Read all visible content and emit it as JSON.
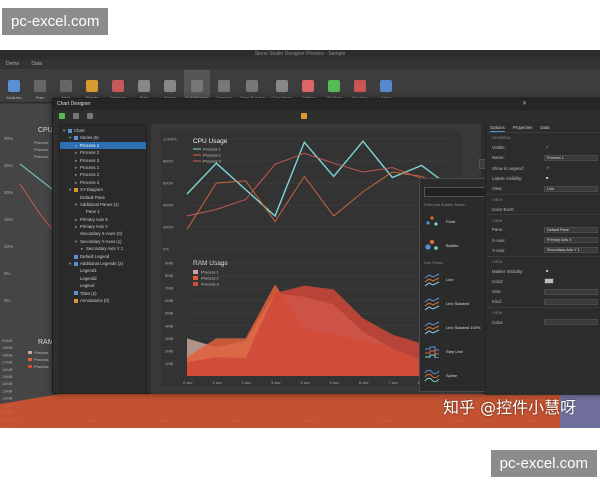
{
  "watermarks": {
    "top": "pc-excel.com",
    "bottom": "pc-excel.com",
    "chinese": "知乎 @控件小慧呀"
  },
  "app": {
    "title": "Stone Studio Designer Preview - Sample",
    "menu": [
      "Demo",
      "Data"
    ],
    "ribbon": [
      {
        "label": "Modules",
        "icon": "modules-icon",
        "color": "#5a8fd4"
      },
      {
        "label": "Prev",
        "icon": "prev-icon",
        "color": "#666"
      },
      {
        "label": "Next",
        "icon": "next-icon",
        "color": "#666"
      },
      {
        "label": "Palette",
        "icon": "palette-icon",
        "color": "#d79a2e"
      },
      {
        "label": "Designer",
        "icon": "designer-icon",
        "color": "#c45a5a"
      },
      {
        "label": "Print",
        "icon": "print-icon",
        "color": "#888"
      },
      {
        "label": "Export",
        "icon": "export-icon",
        "color": "#888"
      },
      {
        "label": "Full Window",
        "icon": "full-window-icon",
        "color": "#777"
      },
      {
        "label": "Compact",
        "icon": "compact-icon",
        "color": "#777"
      },
      {
        "label": "Open Solution",
        "icon": "open-solution-icon",
        "color": "#777"
      },
      {
        "label": "Copy Demo",
        "icon": "copy-demo-icon",
        "color": "#888"
      },
      {
        "label": "Getting",
        "icon": "getting-icon",
        "color": "#d66"
      },
      {
        "label": "Get Free",
        "icon": "get-free-icon",
        "color": "#5b5"
      },
      {
        "label": "Buy Now",
        "icon": "buy-now-icon",
        "color": "#c55"
      },
      {
        "label": "About",
        "icon": "about-icon",
        "color": "#58c"
      }
    ]
  },
  "designer": {
    "title": "Chart Designer",
    "tree": [
      {
        "label": "Chart",
        "indent": 0,
        "arrow": "▾",
        "color": "#5a8fd4"
      },
      {
        "label": "Series (6)",
        "indent": 1,
        "arrow": "▾",
        "color": "#5a8fd4"
      },
      {
        "label": "Process 1",
        "indent": 2,
        "arrow": "▸",
        "color": "",
        "selected": true
      },
      {
        "label": "Process 2",
        "indent": 2,
        "arrow": "▸",
        "color": ""
      },
      {
        "label": "Process 3",
        "indent": 2,
        "arrow": "▸",
        "color": ""
      },
      {
        "label": "Process 1",
        "indent": 2,
        "arrow": "▸",
        "color": ""
      },
      {
        "label": "Process 2",
        "indent": 2,
        "arrow": "▸",
        "color": ""
      },
      {
        "label": "Process 3",
        "indent": 2,
        "arrow": "▸",
        "color": ""
      },
      {
        "label": "XY-Diagram",
        "indent": 1,
        "arrow": "▾",
        "color": "#d79a2e"
      },
      {
        "label": "Default Pane",
        "indent": 2,
        "arrow": "",
        "color": ""
      },
      {
        "label": "Additional Panes (1)",
        "indent": 2,
        "arrow": "▾",
        "color": ""
      },
      {
        "label": "Pane 1",
        "indent": 3,
        "arrow": "",
        "color": ""
      },
      {
        "label": "Primary Axis X",
        "indent": 2,
        "arrow": "▸",
        "color": ""
      },
      {
        "label": "Primary Axis Y",
        "indent": 2,
        "arrow": "▸",
        "color": ""
      },
      {
        "label": "Secondary X-Axes (0)",
        "indent": 2,
        "arrow": "",
        "color": ""
      },
      {
        "label": "Secondary Y-Axes (1)",
        "indent": 2,
        "arrow": "▾",
        "color": ""
      },
      {
        "label": "Secondary Axis Y 1",
        "indent": 3,
        "arrow": "▸",
        "color": ""
      },
      {
        "label": "Default Legend",
        "indent": 1,
        "arrow": "",
        "color": "#5a8fd4"
      },
      {
        "label": "Additional Legends (2)",
        "indent": 1,
        "arrow": "▾",
        "color": "#5a8fd4"
      },
      {
        "label": "Legend1",
        "indent": 2,
        "arrow": "",
        "color": ""
      },
      {
        "label": "Legend2",
        "indent": 2,
        "arrow": "",
        "color": ""
      },
      {
        "label": "Legend",
        "indent": 2,
        "arrow": "",
        "color": ""
      },
      {
        "label": "Titles (2)",
        "indent": 1,
        "arrow": "",
        "color": "#5a8fd4"
      },
      {
        "label": "Annotations (0)",
        "indent": 1,
        "arrow": "",
        "color": "#d79a2e"
      }
    ],
    "legend_button": "Empty Legend",
    "gallery": {
      "search_placeholder": "",
      "group_points": "Point and Bubble Series",
      "group_line": "Line Series",
      "items": [
        {
          "label": "Point",
          "icon": "point-series-icon"
        },
        {
          "label": "Bubble",
          "icon": "bubble-series-icon"
        },
        {
          "label": "Line",
          "icon": "line-series-icon"
        },
        {
          "label": "Line Stacked",
          "icon": "line-stacked-icon"
        },
        {
          "label": "Line Stacked 100%",
          "icon": "line-stacked-100-icon"
        },
        {
          "label": "Step Line",
          "icon": "step-line-icon"
        },
        {
          "label": "Spline",
          "icon": "spline-icon"
        }
      ]
    },
    "props": {
      "tabs": [
        "Options",
        "Properties",
        "Data"
      ],
      "rows": [
        {
          "type": "sect",
          "label": "GENERAL"
        },
        {
          "label": "Visible:",
          "value": "✓",
          "kind": "check"
        },
        {
          "label": "Name:",
          "value": "Process 1",
          "kind": "input"
        },
        {
          "label": "Show in Legend:",
          "value": "✓",
          "kind": "check"
        },
        {
          "label": "Labels Visibility:",
          "value": "■",
          "kind": "check"
        },
        {
          "label": "View:",
          "value": "Line",
          "kind": "input"
        },
        {
          "type": "sect",
          "label": "VIEW"
        },
        {
          "label": "Color Each:",
          "value": "",
          "kind": "check"
        },
        {
          "type": "sect",
          "label": "VIEW"
        },
        {
          "label": "Pane:",
          "value": "Default Pane",
          "kind": "input"
        },
        {
          "label": "X-Axis:",
          "value": "Primary Axis X",
          "kind": "input"
        },
        {
          "label": "Y-Axis:",
          "value": "Secondary Axis Y 1",
          "kind": "input"
        },
        {
          "type": "sect",
          "label": "VIEW"
        },
        {
          "label": "Marker Visibility:",
          "value": "■",
          "kind": "check"
        },
        {
          "label": "Color:",
          "value": "",
          "kind": "swatch"
        },
        {
          "label": "Size:",
          "value": "",
          "kind": "input"
        },
        {
          "label": "Kind:",
          "value": "",
          "kind": "input"
        },
        {
          "type": "sect",
          "label": "VIEW"
        },
        {
          "label": "Color:",
          "value": "",
          "kind": "input"
        }
      ]
    }
  },
  "chart_data": [
    {
      "type": "line",
      "title": "CPU Usage",
      "x": [
        "0 sec",
        "1 sec",
        "2 sec",
        "3 sec",
        "4 sec",
        "5 sec",
        "6 sec",
        "7 sec",
        "8 sec",
        "9 sec"
      ],
      "y_ticks": [
        "1,000%",
        "800%",
        "600%",
        "400%",
        "200%",
        "0%"
      ],
      "ylim": [
        0,
        1000
      ],
      "series": [
        {
          "name": "Process 1",
          "color": "#7fd6d6",
          "values": [
            500,
            780,
            540,
            300,
            970,
            660,
            980,
            650,
            760,
            560
          ]
        },
        {
          "name": "Process 2",
          "color": "#d86b3a",
          "values": [
            180,
            600,
            620,
            250,
            660,
            300,
            520,
            700,
            660,
            520
          ]
        },
        {
          "name": "Process 3",
          "color": "#c95a57",
          "values": [
            300,
            360,
            450,
            770,
            870,
            780,
            700,
            740,
            640,
            480
          ]
        }
      ]
    },
    {
      "type": "area",
      "title": "RAM Usage",
      "x": [
        "0 sec",
        "1 sec",
        "2 sec",
        "3 sec",
        "4 sec",
        "5 sec",
        "6 sec",
        "7 sec",
        "8 sec",
        "9 sec"
      ],
      "y_ticks": [
        "9MB",
        "8MB",
        "7MB",
        "6MB",
        "5MB",
        "4MB",
        "3MB",
        "2MB",
        "1MB"
      ],
      "ylim": [
        0,
        9
      ],
      "series": [
        {
          "name": "Process 1",
          "color": "#c9a59a",
          "values": [
            3.0,
            2.3,
            2.8,
            6.6,
            6.3,
            5.7,
            3.5,
            2.2,
            1.2,
            1.3
          ]
        },
        {
          "name": "Process 2",
          "color": "#e0603a",
          "values": [
            1.5,
            3.0,
            3.0,
            7.3,
            3.8,
            3.3,
            2.8,
            2.2,
            1.1,
            0.8
          ]
        },
        {
          "name": "Process 3",
          "color": "#d04838",
          "values": [
            1.1,
            1.5,
            1.4,
            6.6,
            7.2,
            6.9,
            4.6,
            3.3,
            2.6,
            2.2
          ]
        }
      ]
    }
  ],
  "background": {
    "cpu_label": "CPU",
    "ram_label": "RAM",
    "left_processes": [
      "Process",
      "Process",
      "Process"
    ],
    "y_left": [
      "30%",
      "25%",
      "20%",
      "15%",
      "10%",
      "5%",
      "0%"
    ],
    "mb_left": [
      "20MB",
      "19MB",
      "18MB",
      "17MB",
      "16MB",
      "15MB",
      "14MB",
      "13MB",
      "12MB",
      "11MB",
      "10MB",
      "9MB",
      "8MB"
    ],
    "bottom_x": [
      "0 sec",
      "1 sec",
      "2 sec",
      "3 sec",
      "4 sec",
      "5 sec",
      "6 sec",
      "7 sec",
      "8 sec"
    ]
  }
}
